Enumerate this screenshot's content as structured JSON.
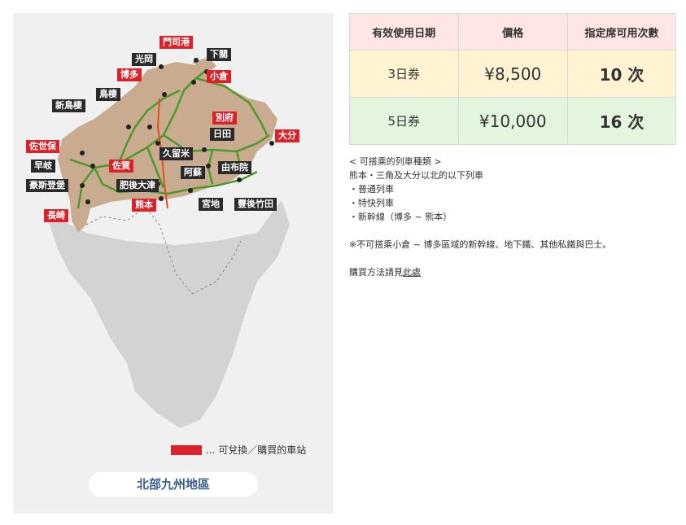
{
  "map": {
    "stations": {
      "mojiko": "門司港",
      "kouno": "光岡",
      "shimonoseki": "下關",
      "hakata": "博多",
      "kokura": "小倉",
      "tosu": "鳥棲",
      "shintosu": "新鳥棲",
      "beppu": "別府",
      "hita": "日田",
      "oita": "大分",
      "sasebo": "佐世保",
      "kurume": "久留米",
      "haiki": "早岐",
      "saga": "佐賀",
      "aso": "阿蘇",
      "yufuin": "由布院",
      "huistenbosch": "豪斯登堡",
      "higoozu": "肥後大津",
      "kumamoto": "熊本",
      "miyaji": "宮地",
      "bungotaketa": "豐後竹田",
      "nagasaki": "長崎"
    },
    "legend_text": "... 可兌換／購買的車站",
    "region_label": "北部九州地區"
  },
  "price_table": {
    "headers": [
      "有效使用日期",
      "價格",
      "指定席可用次數"
    ],
    "rows": [
      {
        "days": "3日券",
        "price": "¥8,500",
        "seats": "10 次"
      },
      {
        "days": "5日券",
        "price": "¥10,000",
        "seats": "16 次"
      }
    ]
  },
  "notes": {
    "train_types_title": "< 可搭乘的列車種類 >",
    "area_line": "熊本・三角及大分以北的以下列車",
    "items": [
      "・普通列車",
      "・特快列車",
      "・新幹線（博多 ~ 熊本）"
    ],
    "warning": "※不可搭乘小倉 ~ 博多區域的新幹線、地下鐵、其他私鐵與巴士。",
    "purchase_prefix": "購買方法請見",
    "purchase_link": "此處"
  },
  "colors": {
    "station_red": "#d9222a",
    "station_dark": "#2a2a2a",
    "rail_green": "#4c9a2a",
    "shinkansen": "#e2501e",
    "region_brown": "#c9ab90",
    "land_grey": "#d3d3d3",
    "header_pink": "#fde6e3",
    "row_yellow": "#fff3d2",
    "row_green": "#e4f5df",
    "region_label_blue": "#3a5e8c"
  }
}
